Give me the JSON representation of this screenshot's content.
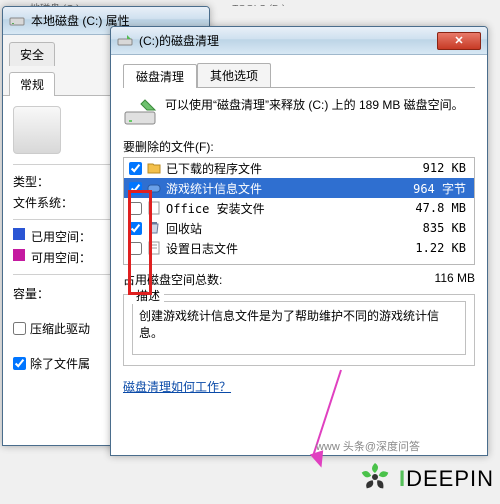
{
  "topbar": {
    "left": "地磁盘 (C:)",
    "right": "TOOLS (D:)"
  },
  "prop": {
    "title": "本地磁盘 (C:) 属性",
    "tabs": {
      "security": "安全",
      "general": "常规"
    },
    "labels": {
      "type": "类型：",
      "filesystem": "文件系统：",
      "used": "已用空间：",
      "free": "可用空间：",
      "capacity": "容量："
    },
    "colors": {
      "used": "#2a55d4",
      "free": "#c41aa0"
    },
    "checks": {
      "compress": "压缩此驱动",
      "index": "除了文件属"
    }
  },
  "clean": {
    "title": "(C:)的磁盘清理",
    "tabs": {
      "cleanup": "磁盘清理",
      "more": "其他选项"
    },
    "intro": "可以使用“磁盘清理”来释放 (C:) 上的 189 MB 磁盘空间。",
    "list_header": "要删除的文件(F):",
    "files": [
      {
        "checked": true,
        "name": "已下载的程序文件",
        "size": "912 KB"
      },
      {
        "checked": true,
        "name": "游戏统计信息文件",
        "size": "964 字节",
        "selected": true
      },
      {
        "checked": false,
        "name": "Office 安装文件",
        "size": "47.8 MB"
      },
      {
        "checked": true,
        "name": "回收站",
        "size": "835 KB"
      },
      {
        "checked": false,
        "name": "设置日志文件",
        "size": "1.22 KB"
      }
    ],
    "total": {
      "label": "占用磁盘空间总数:",
      "value": "116 MB"
    },
    "desc": {
      "legend": "描述",
      "text": "创建游戏统计信息文件是为了帮助维护不同的游戏统计信息。"
    },
    "link": "磁盘清理如何工作？"
  },
  "close_glyph": "✕",
  "watermark": "www 头条@深度问答",
  "brand": {
    "i": "I",
    "rest": "DEEPIN"
  }
}
